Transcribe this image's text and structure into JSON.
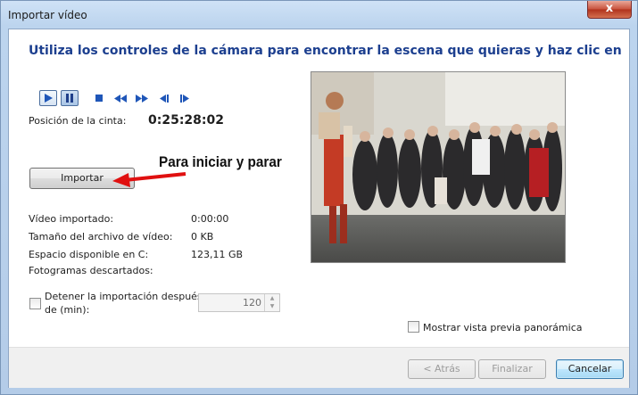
{
  "window": {
    "title": "Importar vídeo",
    "close_glyph": "x"
  },
  "heading": "Utiliza los controles de la cámara para encontrar la escena que quieras y haz clic en",
  "transport": {
    "icons": [
      "play-icon",
      "pause-icon",
      "stop-icon",
      "rewind-icon",
      "fast-forward-icon",
      "previous-frame-icon",
      "next-frame-icon"
    ],
    "accent": "#1f56b8"
  },
  "tape_position": {
    "label": "Posición de la cinta:",
    "value": "0:25:28:02"
  },
  "annotation": {
    "text": "Para iniciar y parar",
    "arrow_color": "#e01010"
  },
  "import_button": "Importar",
  "stats": [
    {
      "label": "Vídeo importado:",
      "value": "0:00:00"
    },
    {
      "label": "Tamaño del archivo de vídeo:",
      "value": "0 KB"
    },
    {
      "label": "Espacio disponible en C:",
      "value": "123,11 GB"
    },
    {
      "label": "Fotogramas descartados:",
      "value": ""
    }
  ],
  "stop_import": {
    "label_line1": "Detener la importación después",
    "label_line2": "de (min):",
    "checked": false,
    "minutes": "120"
  },
  "widescreen": {
    "label": "Mostrar vista previa panorámica",
    "checked": false
  },
  "buttons": {
    "back": "< Atrás",
    "finish": "Finalizar",
    "cancel": "Cancelar"
  }
}
